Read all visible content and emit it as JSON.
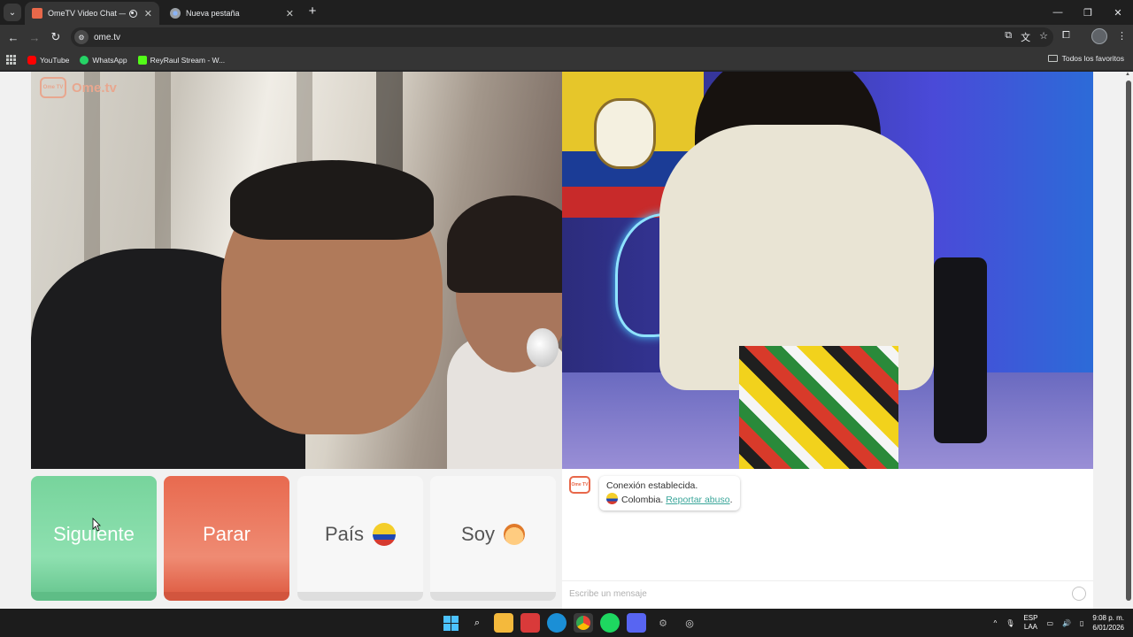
{
  "browser": {
    "tabs": [
      {
        "title": "OmeTV Video Chat — Ome",
        "active": true
      },
      {
        "title": "Nueva pestaña",
        "active": false
      }
    ],
    "url": "ome.tv",
    "bookmarks": [
      {
        "label": "YouTube",
        "icon": "youtube-icon",
        "color": "#ff0000"
      },
      {
        "label": "WhatsApp",
        "icon": "whatsapp-icon",
        "color": "#25d366"
      },
      {
        "label": "ReyRaul Stream - W...",
        "icon": "kick-icon",
        "color": "#53fc18"
      }
    ],
    "all_bookmarks": "Todos los favoritos"
  },
  "page": {
    "logo_text": "Ome.tv",
    "logo_badge": "Ome TV",
    "buttons": {
      "next": "Siguiente",
      "stop": "Parar",
      "country": "País",
      "gender": "Soy"
    },
    "chat": {
      "status": "Conexión establecida.",
      "country": "Colombia.",
      "report": "Reportar abuso",
      "report_suffix": ".",
      "placeholder": "Escribe un mensaje"
    },
    "colors": {
      "next": "#77d49c",
      "stop": "#e86a4f",
      "accent": "#e8684a"
    }
  },
  "taskbar": {
    "lang_top": "ESP",
    "lang_bottom": "LAA",
    "time": "9:08 p. m.",
    "date": "6/01/2026"
  }
}
